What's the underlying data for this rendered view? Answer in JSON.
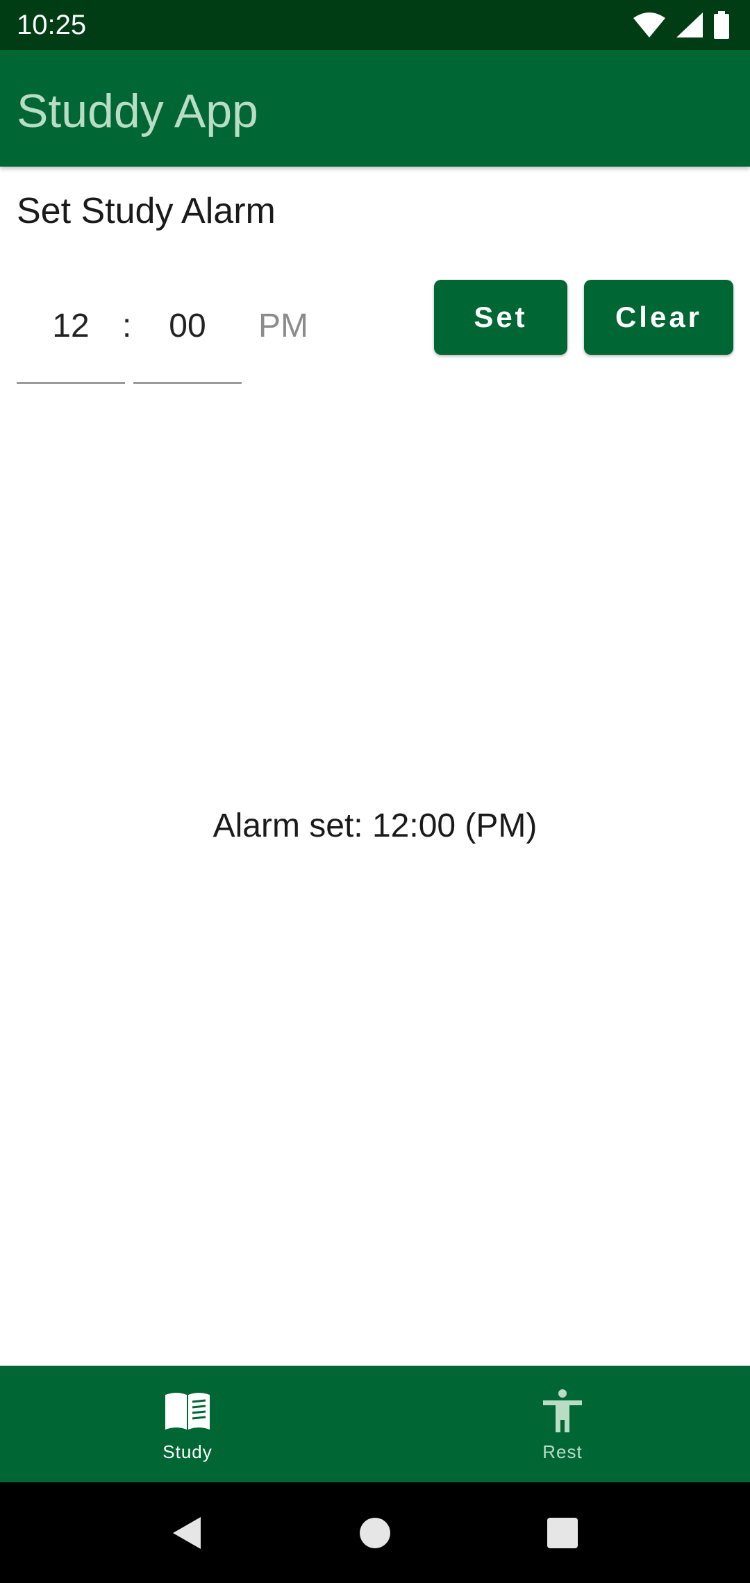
{
  "status_bar": {
    "time": "10:25",
    "icons": [
      "wifi-icon",
      "signal-icon",
      "battery-icon"
    ]
  },
  "app_bar": {
    "title": "Studdy App"
  },
  "alarm_form": {
    "section_title": "Set Study Alarm",
    "hour": "12",
    "separator": ":",
    "minute": "00",
    "ampm": "PM",
    "set_label": "Set",
    "clear_label": "Clear"
  },
  "alarm_status": "Alarm set: 12:00 (PM)",
  "bottom_nav": {
    "items": [
      {
        "label": "Study",
        "icon": "book-icon",
        "selected": true
      },
      {
        "label": "Rest",
        "icon": "accessibility-icon",
        "selected": false
      }
    ]
  },
  "colors": {
    "status_bar": "#003d14",
    "primary": "#006633",
    "title_text": "#b8dcc4"
  }
}
